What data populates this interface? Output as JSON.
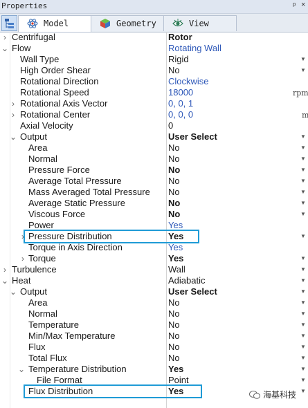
{
  "window": {
    "title": "Properties",
    "pin_glyph": "ᵖ",
    "close_glyph": "×"
  },
  "tabs": [
    {
      "label": "Model",
      "icon": "atom-icon"
    },
    {
      "label": "Geometry",
      "icon": "cube-icon"
    },
    {
      "label": "View",
      "icon": "eye-icon"
    }
  ],
  "rows": [
    {
      "name": "Centrifugal",
      "value": "Rotor"
    },
    {
      "name": "Flow",
      "value": "Rotating Wall"
    },
    {
      "name": "Wall Type",
      "value": "Rigid"
    },
    {
      "name": "High Order Shear",
      "value": "No"
    },
    {
      "name": "Rotational Direction",
      "value": "Clockwise"
    },
    {
      "name": "Rotational Speed",
      "value": "18000",
      "unit": "rpm"
    },
    {
      "name": "Rotational Axis Vector",
      "value": "0, 0, 1"
    },
    {
      "name": "Rotational Center",
      "value": "0, 0, 0",
      "unit": "m"
    },
    {
      "name": "Axial Velocity",
      "value": "0"
    },
    {
      "name": "Output",
      "value": "User Select"
    },
    {
      "name": "Area",
      "value": "No"
    },
    {
      "name": "Normal",
      "value": "No"
    },
    {
      "name": "Pressure Force",
      "value": "No"
    },
    {
      "name": "Average Total Pressure",
      "value": "No"
    },
    {
      "name": "Mass Averaged Total Pressure",
      "value": "No"
    },
    {
      "name": "Average Static Pressure",
      "value": "No"
    },
    {
      "name": "Viscous Force",
      "value": "No"
    },
    {
      "name": "Power",
      "value": "Yes"
    },
    {
      "name": "Pressure Distribution",
      "value": "Yes"
    },
    {
      "name": "Torque in Axis Direction",
      "value": "Yes"
    },
    {
      "name": "Torque",
      "value": "Yes"
    },
    {
      "name": "Turbulence",
      "value": "Wall"
    },
    {
      "name": "Heat",
      "value": "Adiabatic"
    },
    {
      "name": "Output",
      "value": "User Select"
    },
    {
      "name": "Area",
      "value": "No"
    },
    {
      "name": "Normal",
      "value": "No"
    },
    {
      "name": "Temperature",
      "value": "No"
    },
    {
      "name": "Min/Max Temperature",
      "value": "No"
    },
    {
      "name": "Flux",
      "value": "No"
    },
    {
      "name": "Total Flux",
      "value": "No"
    },
    {
      "name": "Temperature Distribution",
      "value": "Yes"
    },
    {
      "name": "File Format",
      "value": "Point"
    },
    {
      "name": "Flux Distribution",
      "value": "Yes"
    }
  ],
  "expander_glyphs": {
    "collapsed": "›",
    "expanded": "⌄"
  },
  "watermark": {
    "text": "海基科技"
  },
  "colors": {
    "highlight": "#1f9bd6",
    "link_blue": "#2e58b8"
  }
}
